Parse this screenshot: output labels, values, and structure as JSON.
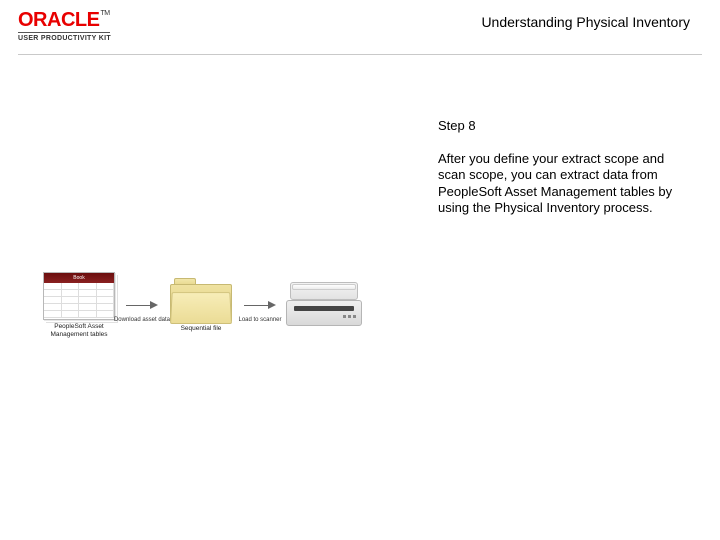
{
  "header": {
    "brand": "ORACLE",
    "tm": "TM",
    "subline": "USER PRODUCTIVITY KIT",
    "title": "Understanding Physical Inventory"
  },
  "step": {
    "label": "Step 8",
    "description": "After you define your extract scope and scan scope, you can extract data from PeopleSoft Asset Management tables by using the Physical Inventory process."
  },
  "diagram": {
    "db_header": "Book",
    "db_caption": "PeopleSoft Asset Management tables",
    "arrow1_label": "Download asset data",
    "folder_caption": "Sequential file",
    "arrow2_label": "Load to scanner",
    "scanner_caption": ""
  }
}
